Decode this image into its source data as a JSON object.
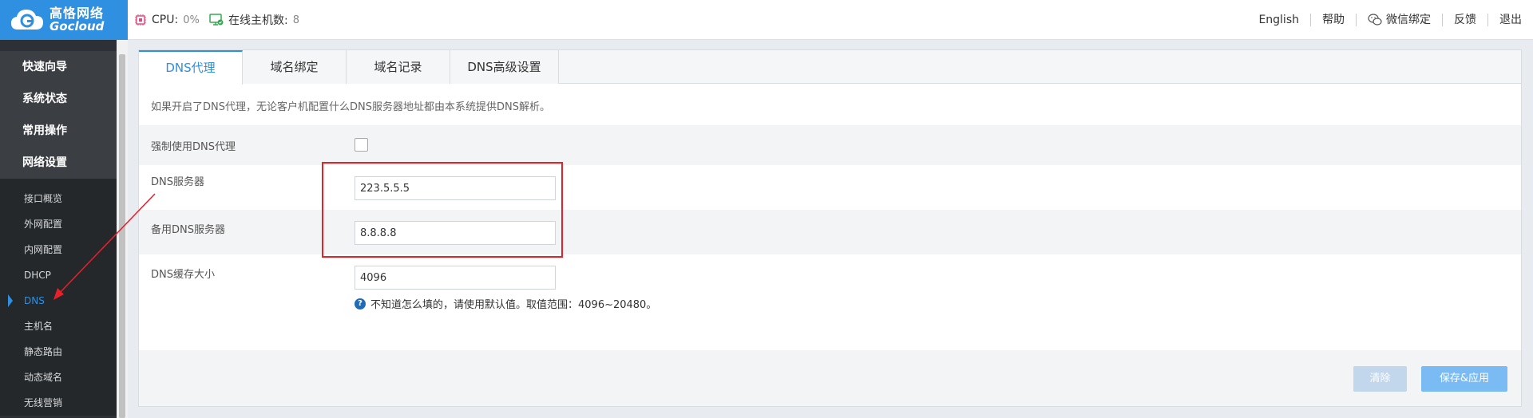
{
  "brand": {
    "name_cn": "高恪网络",
    "name_en": "Gocloud"
  },
  "status": {
    "cpu_label": "CPU:",
    "cpu_value": "0%",
    "online_label": "在线主机数:",
    "online_value": "8"
  },
  "topnav": {
    "english": "English",
    "help": "帮助",
    "wechat": "微信绑定",
    "feedback": "反馈",
    "logout": "退出"
  },
  "sidebar": {
    "groups": [
      {
        "label": "快速向导"
      },
      {
        "label": "系统状态"
      },
      {
        "label": "常用操作"
      },
      {
        "label": "网络设置"
      }
    ],
    "items": [
      {
        "label": "接口概览"
      },
      {
        "label": "外网配置"
      },
      {
        "label": "内网配置"
      },
      {
        "label": "DHCP"
      },
      {
        "label": "DNS",
        "active": true
      },
      {
        "label": "主机名"
      },
      {
        "label": "静态路由"
      },
      {
        "label": "动态域名"
      },
      {
        "label": "无线营销"
      }
    ]
  },
  "tabs": [
    {
      "label": "DNS代理",
      "active": true
    },
    {
      "label": "域名绑定"
    },
    {
      "label": "域名记录"
    },
    {
      "label": "DNS高级设置"
    }
  ],
  "note": "如果开启了DNS代理，无论客户机配置什么DNS服务器地址都由本系统提供DNS解析。",
  "form": {
    "force_label": "强制使用DNS代理",
    "force_checked": false,
    "dns_label": "DNS服务器",
    "dns_value": "223.5.5.5",
    "backup_label": "备用DNS服务器",
    "backup_value": "8.8.8.8",
    "cache_label": "DNS缓存大小",
    "cache_value": "4096",
    "cache_hint": "不知道怎么填的，请使用默认值。取值范围：4096~20480。"
  },
  "buttons": {
    "clear": "清除",
    "save": "保存&应用"
  },
  "colors": {
    "accent": "#2f8fe0",
    "annotation": "#e8202a",
    "sidebar_bg": "#2d3034"
  }
}
